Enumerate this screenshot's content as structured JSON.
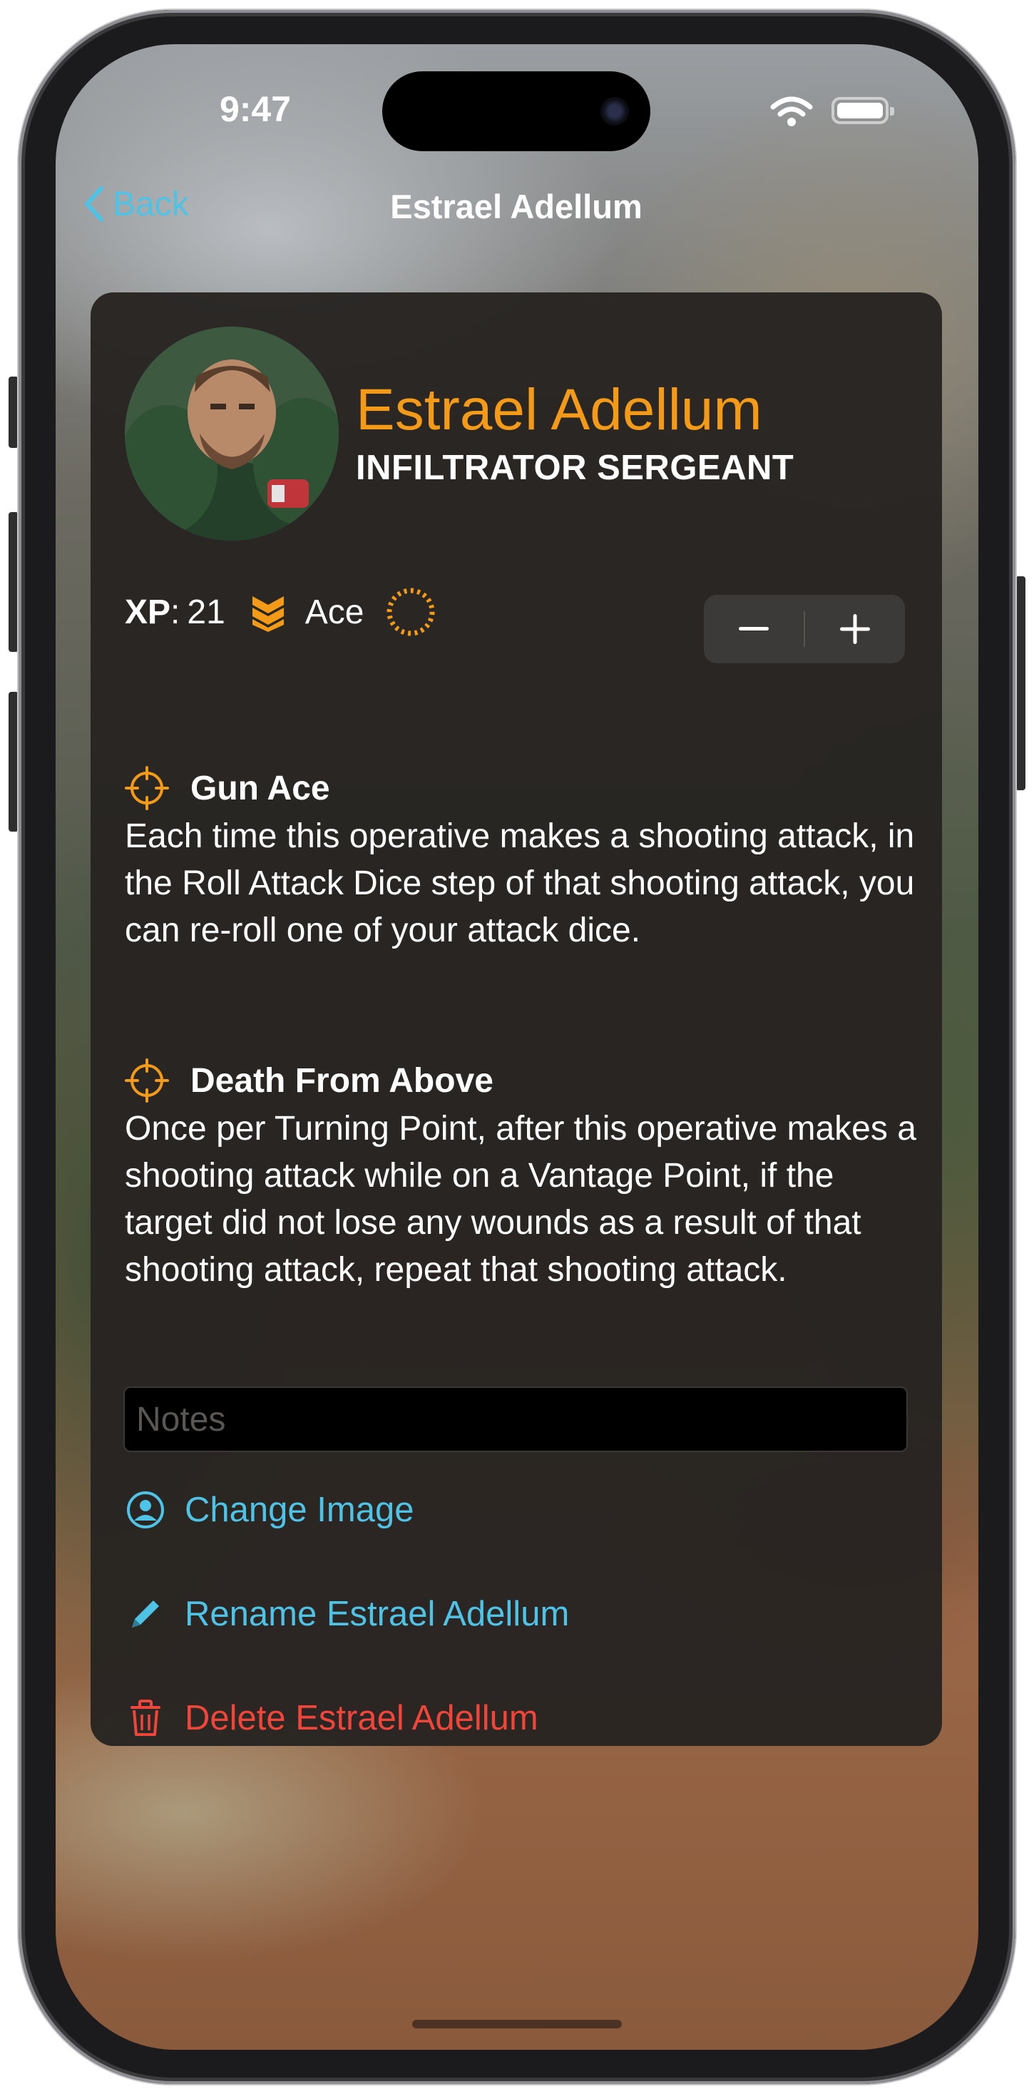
{
  "status_bar": {
    "time": "9:47"
  },
  "nav": {
    "back_label": "Back",
    "title": "Estrael Adellum"
  },
  "operative": {
    "name": "Estrael Adellum",
    "type": "INFILTRATOR SERGEANT",
    "avatar_icon": "miniature-portrait",
    "xp_label": "XP",
    "xp_separator": ":",
    "xp_value": "21",
    "rank_icon": "chevron-rank-icon",
    "rank": "Ace",
    "progress_icon": "dashed-progress-ring-icon"
  },
  "stepper": {
    "decrement_icon": "minus-icon",
    "increment_icon": "plus-icon"
  },
  "abilities": [
    {
      "icon": "crosshair-icon",
      "title": "Gun Ace",
      "description": "Each time this operative makes a shooting attack, in the Roll Attack Dice step of that shooting attack, you can re-roll one of your attack dice."
    },
    {
      "icon": "crosshair-icon",
      "title": "Death From Above",
      "description": "Once per Turning Point, after this operative makes a shooting attack while on a Vantage Point, if the target did not lose any wounds as a result of that shooting attack, repeat that shooting attack."
    }
  ],
  "notes": {
    "placeholder": "Notes",
    "value": ""
  },
  "actions": {
    "change_image": "Change Image",
    "rename": "Rename Estrael Adellum",
    "delete": "Delete Estrael Adellum"
  },
  "colors": {
    "accent_orange": "#f39a19",
    "link_blue": "#4fc3e6",
    "destructive_red": "#f0453a",
    "card_background": "#262321"
  }
}
